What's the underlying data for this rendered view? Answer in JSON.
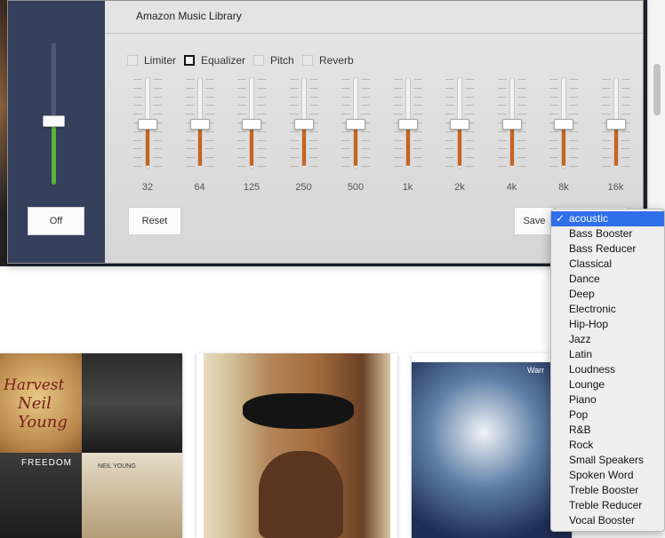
{
  "window": {
    "title": "Amazon Music Library"
  },
  "volume": {
    "level": 0.45,
    "off_label": "Off"
  },
  "effects": [
    {
      "label": "Limiter",
      "checked": false
    },
    {
      "label": "Equalizer",
      "checked": true
    },
    {
      "label": "Pitch",
      "checked": false
    },
    {
      "label": "Reverb",
      "checked": false
    }
  ],
  "bands": [
    {
      "freq": "32",
      "level": 0.5
    },
    {
      "freq": "64",
      "level": 0.5
    },
    {
      "freq": "125",
      "level": 0.5
    },
    {
      "freq": "250",
      "level": 0.5
    },
    {
      "freq": "500",
      "level": 0.5
    },
    {
      "freq": "1k",
      "level": 0.5
    },
    {
      "freq": "2k",
      "level": 0.5
    },
    {
      "freq": "4k",
      "level": 0.5
    },
    {
      "freq": "8k",
      "level": 0.5
    },
    {
      "freq": "16k",
      "level": 0.5
    }
  ],
  "buttons": {
    "reset_label": "Reset",
    "save_label": "Save"
  },
  "presets": {
    "selected": "acoustic",
    "items": [
      "acoustic",
      "Bass Booster",
      "Bass Reducer",
      "Classical",
      "Dance",
      "Deep",
      "Electronic",
      "Hip-Hop",
      "Jazz",
      "Latin",
      "Loudness",
      "Lounge",
      "Piano",
      "Pop",
      "R&B",
      "Rock",
      "Small Speakers",
      "Spoken Word",
      "Treble Booster",
      "Treble Reducer",
      "Vocal Booster"
    ]
  },
  "albums": {
    "harvest_line1": "Harvest",
    "harvest_line2": "Neil Young",
    "freedom": "FREEDOM",
    "neil_young": "NEIL YOUNG",
    "warren": "Warr"
  },
  "colors": {
    "eq_fill": "#c9641c",
    "volume_fill": "#5cb23b",
    "selection": "#2f6fe8",
    "volume_pane": "#34405c"
  }
}
